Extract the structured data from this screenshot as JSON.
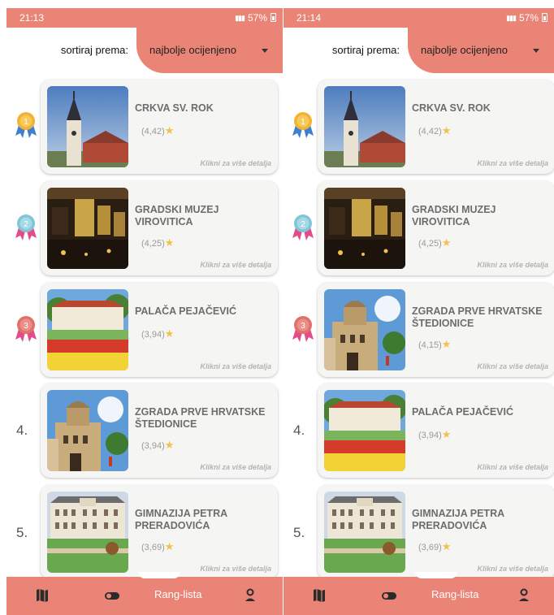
{
  "screens": [
    {
      "status": {
        "time": "21:13",
        "battery": "57%"
      },
      "sort": {
        "label": "sortiraj prema:",
        "value": "najbolje ocijenjeno"
      },
      "items": [
        {
          "rank": "1",
          "title": "CRKVA SV. ROK",
          "rating": "(4,42)",
          "detail": "Klikni za više detalja",
          "image": "church"
        },
        {
          "rank": "2",
          "title": "GRADSKI MUZEJ VIROVITICA",
          "rating": "(4,25)",
          "detail": "Klikni za više detalja",
          "image": "museum"
        },
        {
          "rank": "3",
          "title": "PALAČA PEJAČEVIĆ",
          "rating": "(3,94)",
          "detail": "Klikni za više detalja",
          "image": "palace"
        },
        {
          "rank": "4.",
          "title": "ZGRADA PRVE HRVATSKE ŠTEDIONICE",
          "rating": "(3,94)",
          "detail": "Klikni za više detalja",
          "image": "savings"
        },
        {
          "rank": "5.",
          "title": "GIMNAZIJA PETRA PRERADOVIĆA",
          "rating": "(3,69)",
          "detail": "Klikni za više detalja",
          "image": "gymnasium"
        }
      ],
      "nav": {
        "active_label": "Rang-lista"
      }
    },
    {
      "status": {
        "time": "21:14",
        "battery": "57%"
      },
      "sort": {
        "label": "sortiraj prema:",
        "value": "najbolje ocijenjeno"
      },
      "items": [
        {
          "rank": "1",
          "title": "CRKVA SV. ROK",
          "rating": "(4,42)",
          "detail": "Klikni za više detalja",
          "image": "church"
        },
        {
          "rank": "2",
          "title": "GRADSKI MUZEJ VIROVITICA",
          "rating": "(4,25)",
          "detail": "Klikni za više detalja",
          "image": "museum"
        },
        {
          "rank": "3",
          "title": "ZGRADA PRVE HRVATSKE ŠTEDIONICE",
          "rating": "(4,15)",
          "detail": "Klikni za više detalja",
          "image": "savings"
        },
        {
          "rank": "4.",
          "title": "PALAČA PEJAČEVIĆ",
          "rating": "(3,94)",
          "detail": "Klikni za više detalja",
          "image": "palace"
        },
        {
          "rank": "5.",
          "title": "GIMNAZIJA PETRA PRERADOVIĆA",
          "rating": "(3,69)",
          "detail": "Klikni za više detalja",
          "image": "gymnasium"
        }
      ],
      "nav": {
        "active_label": "Rang-lista"
      }
    }
  ],
  "colors": {
    "accent": "#e98477",
    "gold": "#f2b233",
    "silver": "#7fc6d8",
    "bronze": "#e0706a",
    "ribbon_blue": "#3f7fd0",
    "ribbon_pink": "#e34c8a"
  },
  "icons": [
    "map-icon",
    "toggle-icon",
    "profile-icon",
    "star-icon",
    "medal-icon"
  ]
}
